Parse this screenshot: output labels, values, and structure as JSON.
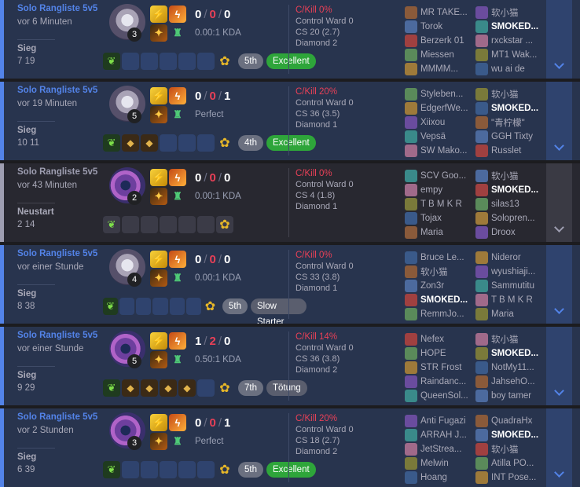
{
  "matches": [
    {
      "type": "win",
      "queue": "Solo Rangliste 5v5",
      "ago": "vor 6 Minuten",
      "result": "Sieg",
      "duration": "7 19",
      "champ_variant": "v1",
      "level": "3",
      "kills": "0",
      "deaths": "0",
      "assists": "0",
      "kda": "0.00:1 KDA",
      "items": [
        "first",
        "empty",
        "empty",
        "empty",
        "empty",
        "empty"
      ],
      "place": "5th",
      "badge": "Excellent",
      "badge_type": "good",
      "pkill": "C/Kill 0%",
      "control_ward": "Control Ward 0",
      "cs": "CS 20 (2.7)",
      "rank": "Diamond 2",
      "team1": [
        "MR TAKE...",
        "Torok",
        "Berzerk 01",
        "Miessen",
        "MMMM..."
      ],
      "team2": [
        "软小猫",
        "SMOKED...",
        "rxckstar ...",
        "MT1 Wak...",
        "wu ai de"
      ]
    },
    {
      "type": "win",
      "queue": "Solo Rangliste 5v5",
      "ago": "vor 19 Minuten",
      "result": "Sieg",
      "duration": "10 11",
      "champ_variant": "v1",
      "level": "5",
      "kills": "0",
      "deaths": "0",
      "assists": "1",
      "kda": "Perfect",
      "items": [
        "first",
        "filled",
        "filled",
        "empty",
        "empty",
        "empty"
      ],
      "place": "4th",
      "badge": "Excellent",
      "badge_type": "good",
      "pkill": "C/Kill 20%",
      "control_ward": "Control Ward 0",
      "cs": "CS 36 (3.5)",
      "rank": "Diamond 1",
      "team1": [
        "Styleben...",
        "EdgerfWe...",
        "Xiixou",
        "Vepsä",
        "SW Mako..."
      ],
      "team2": [
        "软小猫",
        "SMOKED...",
        "\"青柠檬\"",
        "GGH Tixty",
        "Russlet"
      ]
    },
    {
      "type": "remake",
      "queue": "Solo Rangliste 5v5",
      "ago": "vor 43 Minuten",
      "result": "Neustart",
      "duration": "2 14",
      "champ_variant": "v2",
      "level": "2",
      "kills": "0",
      "deaths": "0",
      "assists": "0",
      "kda": "0.00:1 KDA",
      "items": [
        "first",
        "empty",
        "empty",
        "empty",
        "empty",
        "empty"
      ],
      "place": "",
      "badge": "",
      "badge_type": "",
      "pkill": "C/Kill 0%",
      "control_ward": "Control Ward 0",
      "cs": "CS 4 (1.8)",
      "rank": "Diamond 1",
      "team1": [
        "SCV Goo...",
        "empy",
        "T B M K R",
        "Tojax",
        "Maria"
      ],
      "team2": [
        "软小猫",
        "SMOKED...",
        "silas13",
        "Solopren...",
        "Droox"
      ]
    },
    {
      "type": "win",
      "queue": "Solo Rangliste 5v5",
      "ago": "vor einer Stunde",
      "result": "Sieg",
      "duration": "8 38",
      "champ_variant": "v1",
      "level": "4",
      "kills": "0",
      "deaths": "0",
      "assists": "0",
      "kda": "0.00:1 KDA",
      "items": [
        "first",
        "empty",
        "empty",
        "empty",
        "empty",
        "empty"
      ],
      "place": "5th",
      "badge": "Slow Starter",
      "badge_type": "neutral",
      "pkill": "C/Kill 0%",
      "control_ward": "Control Ward 0",
      "cs": "CS 33 (3.8)",
      "rank": "Diamond 1",
      "team1": [
        "Bruce Le...",
        "软小猫",
        "Zon3r",
        "SMOKED...",
        "RemmJo..."
      ],
      "team2": [
        "Nideror",
        "wyushiaji...",
        "Sammutitu",
        "T B M K R",
        "Maria"
      ]
    },
    {
      "type": "win",
      "queue": "Solo Rangliste 5v5",
      "ago": "vor einer Stunde",
      "result": "Sieg",
      "duration": "9 29",
      "champ_variant": "v2",
      "level": "5",
      "kills": "1",
      "deaths": "2",
      "assists": "0",
      "kda": "0.50:1 KDA",
      "items": [
        "first",
        "filled",
        "filled",
        "filled",
        "filled",
        "empty"
      ],
      "place": "7th",
      "badge": "Tötung",
      "badge_type": "neutral",
      "pkill": "C/Kill 14%",
      "control_ward": "Control Ward 0",
      "cs": "CS 36 (3.8)",
      "rank": "Diamond 2",
      "team1": [
        "Nefex",
        "HOPE",
        "STR Frost",
        "Raindanc...",
        "QueenSol..."
      ],
      "team2": [
        "软小猫",
        "SMOKED...",
        "NotMy11...",
        "JahsehO...",
        "boy tamer"
      ]
    },
    {
      "type": "win",
      "queue": "Solo Rangliste 5v5",
      "ago": "vor 2 Stunden",
      "result": "Sieg",
      "duration": "6 39",
      "champ_variant": "v2",
      "level": "3",
      "kills": "0",
      "deaths": "0",
      "assists": "1",
      "kda": "Perfect",
      "items": [
        "first",
        "empty",
        "empty",
        "empty",
        "empty",
        "empty"
      ],
      "place": "5th",
      "badge": "Excellent",
      "badge_type": "good",
      "pkill": "C/Kill 20%",
      "control_ward": "Control Ward 0",
      "cs": "CS 18 (2.7)",
      "rank": "Diamond 2",
      "team1": [
        "Anti Fugazi",
        "ARRAH J...",
        "JetStrea...",
        "Melwin",
        "Hoang"
      ],
      "team2": [
        "QuadraHx",
        "SMOKED...",
        "软小猫",
        "Atilla PO...",
        "INT Pose..."
      ]
    }
  ],
  "me_name": "SMOKED...",
  "icons": {
    "spell_flash": "flash-icon",
    "spell_ignite": "ignite-icon",
    "rune_primary": "electrocute-rune-icon",
    "rune_secondary": "resolve-rune-icon",
    "ward": "ward-trinket-icon",
    "expand": "chevron-down-icon"
  },
  "colors": {
    "win_accent": "#5383e8",
    "win_bg": "#28344e",
    "remake_bg": "#282830",
    "death_red": "#e84057",
    "badge_good": "#2ea53a"
  },
  "avatar_colors": [
    "#8a5a3a",
    "#4c6a9e",
    "#a04040",
    "#5a8a5a",
    "#9e7a3a",
    "#6a4c9e",
    "#3a8a8a",
    "#a06a8a",
    "#7a7a3a",
    "#3a5a8a"
  ]
}
